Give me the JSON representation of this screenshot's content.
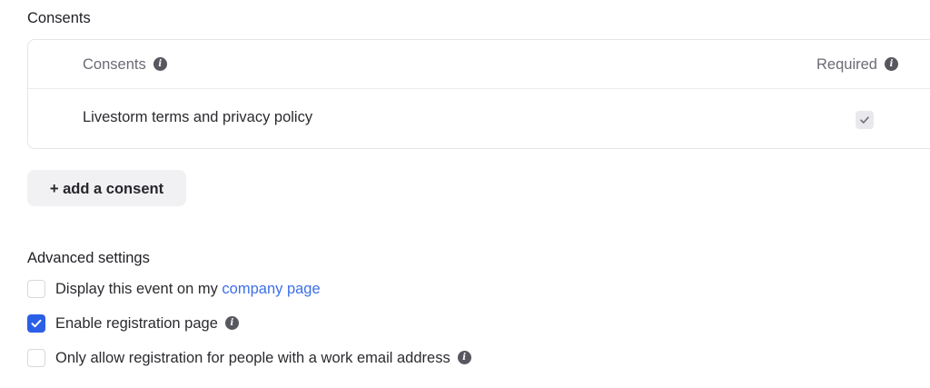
{
  "consents_section": {
    "title": "Consents",
    "table": {
      "header_consents": "Consents",
      "header_required": "Required",
      "rows": [
        {
          "label": "Livestorm terms and privacy policy",
          "required": true
        }
      ]
    },
    "add_button": "+ add a consent"
  },
  "advanced_section": {
    "title": "Advanced settings",
    "options": [
      {
        "prefix": "Display this event on my",
        "link": "company page",
        "checked": false
      },
      {
        "label": "Enable registration page",
        "checked": true
      },
      {
        "label": "Only allow registration for people with a work email address",
        "checked": false
      }
    ]
  },
  "colors": {
    "accent": "#2b5fe6",
    "link": "#3d6fe8",
    "info_icon": "#57575f"
  },
  "icons": {
    "info": "info-icon",
    "check": "check-icon"
  }
}
